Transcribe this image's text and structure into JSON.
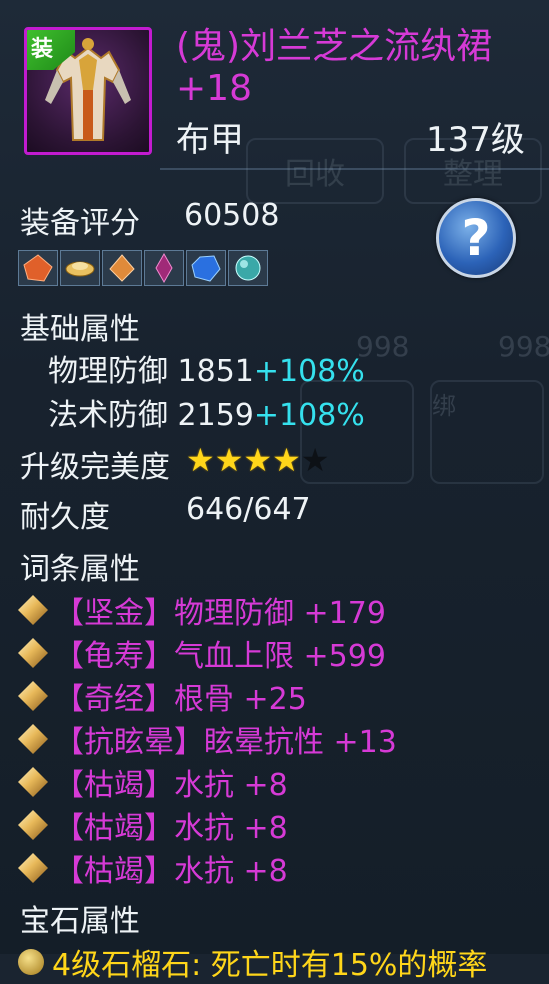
{
  "item": {
    "equip_tag": "装",
    "name": "(鬼)刘兰芝之流纨裙 +18",
    "type": "布甲",
    "level": "137级"
  },
  "score": {
    "label": "装备评分",
    "value": "60508"
  },
  "help_button": {
    "label": "?"
  },
  "gems_row": [
    "orange-gem",
    "gold-ingot",
    "amber-gem",
    "purple-crystal",
    "blue-gem",
    "teal-orb"
  ],
  "base": {
    "label": "基础属性",
    "stats": [
      {
        "name": "物理防御",
        "value": "1851",
        "bonus": "+108%"
      },
      {
        "name": "法术防御",
        "value": "2159",
        "bonus": "+108%"
      }
    ]
  },
  "perfection": {
    "label": "升级完美度",
    "stars_total": 5,
    "stars_filled": 4
  },
  "durability": {
    "label": "耐久度",
    "value": "646/647"
  },
  "affixes": {
    "label": "词条属性",
    "items": [
      "【坚金】物理防御 +179",
      "【龟寿】气血上限 +599",
      "【奇经】根骨 +25",
      "【抗眩晕】眩晕抗性 +13",
      "【枯竭】水抗 +8",
      "【枯竭】水抗 +8",
      "【枯竭】水抗 +8"
    ]
  },
  "gem_section": {
    "label": "宝石属性",
    "first_line": "4级石榴石: 死亡时有15%的概率"
  },
  "background": {
    "btn_a": "回收",
    "btn_b": "整理",
    "count": "998",
    "bind": "绑"
  },
  "colors": {
    "accent_purple": "#d63ad6",
    "cyan": "#35e1ee",
    "star": "#ffd61a",
    "bg": "#1a2430"
  }
}
